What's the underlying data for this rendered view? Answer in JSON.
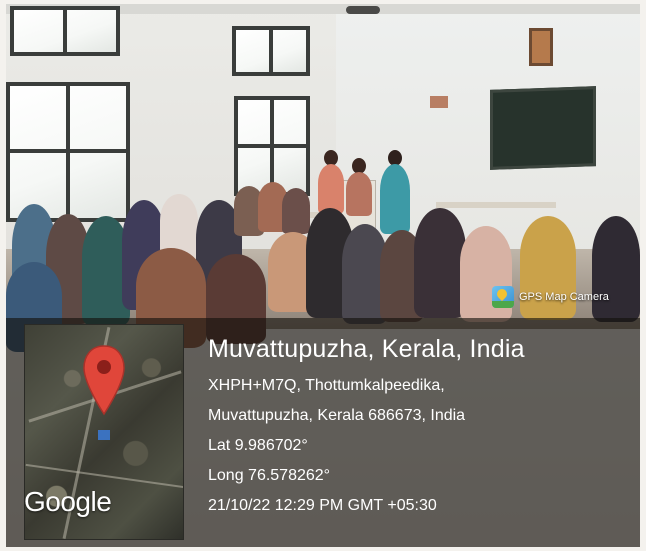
{
  "watermark": {
    "app_name": "GPS Map Camera",
    "location_title": "Muvattupuzha, Kerala, India",
    "address_line_1": "XHPH+M7Q, Thottumkalpeedika,",
    "address_line_2": "Muvattupuzha, Kerala 686673, India",
    "latitude": "Lat 9.986702°",
    "longitude": "Long 76.578262°",
    "datetime": "21/10/22 12:29 PM GMT +05:30",
    "map_brand": "Google",
    "pin_color": "#e0463a",
    "icon": "map-pin-icon"
  },
  "scene": {
    "icon": "classroom-photo"
  }
}
